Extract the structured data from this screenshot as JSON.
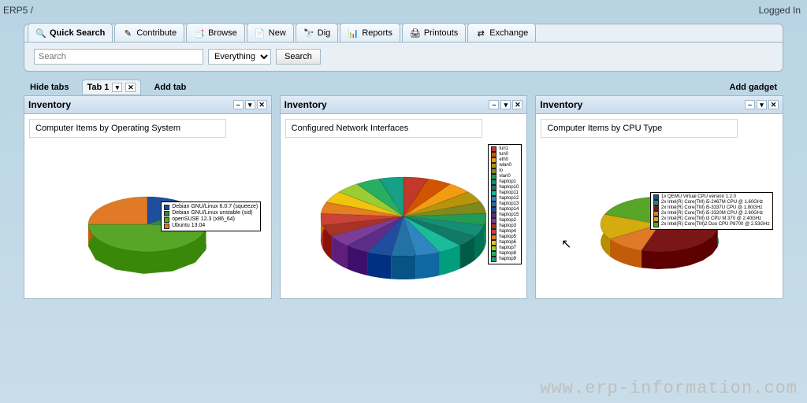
{
  "breadcrumb": "ERP5 /",
  "login_status": "Logged In",
  "nav": {
    "quick_search": "Quick Search",
    "contribute": "Contribute",
    "browse": "Browse",
    "new": "New",
    "dig": "Dig",
    "reports": "Reports",
    "printouts": "Printouts",
    "exchange": "Exchange"
  },
  "search": {
    "placeholder": "Search",
    "select": "Everything",
    "button": "Search"
  },
  "tabbar": {
    "hide": "Hide tabs",
    "tab1": "Tab 1",
    "add_tab": "Add tab",
    "add_gadget": "Add gadget"
  },
  "gadgets": [
    {
      "title": "Inventory",
      "subtitle": "Computer Items by Operating System"
    },
    {
      "title": "Inventory",
      "subtitle": "Configured Network Interfaces"
    },
    {
      "title": "Inventory",
      "subtitle": "Computer Items by CPU Type"
    }
  ],
  "chart_data": [
    {
      "type": "pie",
      "title": "Computer Items by Operating System",
      "series": [
        {
          "name": "Debian GNU/Linux 6.0.7 (squeeze)",
          "value": 15,
          "color": "#1f4e9e"
        },
        {
          "name": "Debian GNU/Linux unstable (sid)",
          "value": 12,
          "color": "#2e8b3d"
        },
        {
          "name": "openSUSE 12.3 (x86_64)",
          "value": 48,
          "color": "#58a628"
        },
        {
          "name": "Ubuntu 13.04",
          "value": 25,
          "color": "#e07a26"
        }
      ]
    },
    {
      "type": "pie",
      "title": "Configured Network Interfaces",
      "series": [
        {
          "name": "tun1",
          "value": 1,
          "color": "#c0392b"
        },
        {
          "name": "tun0",
          "value": 1,
          "color": "#d35400"
        },
        {
          "name": "eth0",
          "value": 1,
          "color": "#f39c12"
        },
        {
          "name": "wlan0",
          "value": 1,
          "color": "#b7950b"
        },
        {
          "name": "lo",
          "value": 1,
          "color": "#7d8a1c"
        },
        {
          "name": "vlan0",
          "value": 1,
          "color": "#239b56"
        },
        {
          "name": "haptop1",
          "value": 1,
          "color": "#148f77"
        },
        {
          "name": "haptop10",
          "value": 1,
          "color": "#117a65"
        },
        {
          "name": "haptop11",
          "value": 1,
          "color": "#1abc9c"
        },
        {
          "name": "haptop12",
          "value": 1,
          "color": "#2e86c1"
        },
        {
          "name": "haptop13",
          "value": 1,
          "color": "#2471a3"
        },
        {
          "name": "haptop14",
          "value": 1,
          "color": "#1f4e9e"
        },
        {
          "name": "haptop15",
          "value": 1,
          "color": "#5b2c8a"
        },
        {
          "name": "haptop2",
          "value": 1,
          "color": "#7d3c98"
        },
        {
          "name": "haptop3",
          "value": 1,
          "color": "#a93226"
        },
        {
          "name": "haptop4",
          "value": 1,
          "color": "#cb4335"
        },
        {
          "name": "haptop5",
          "value": 1,
          "color": "#e67e22"
        },
        {
          "name": "haptop6",
          "value": 1,
          "color": "#f1c40f"
        },
        {
          "name": "haptop7",
          "value": 1,
          "color": "#9acd32"
        },
        {
          "name": "haptop8",
          "value": 1,
          "color": "#27ae60"
        },
        {
          "name": "haptop9",
          "value": 1,
          "color": "#16a085"
        }
      ]
    },
    {
      "type": "pie",
      "title": "Computer Items by CPU Type",
      "series": [
        {
          "name": "1x QEMU Virtual CPU version 1.2.0",
          "value": 14,
          "color": "#1f4e9e"
        },
        {
          "name": "2x Intel(R) Core(TM) i5-2467M CPU @ 1.60GHz",
          "value": 14,
          "color": "#148f77"
        },
        {
          "name": "2x Intel(R) Core(TM) i5-3337U CPU @ 1.80GHz",
          "value": 27,
          "color": "#7a1616"
        },
        {
          "name": "2x Intel(R) Core(TM) i5-3320M CPU @ 2.60GHz",
          "value": 11,
          "color": "#e07a26"
        },
        {
          "name": "2x Intel(R) Core(TM) i3 CPU M 370 @ 2.40GHz",
          "value": 15,
          "color": "#d4ac0d"
        },
        {
          "name": "2x Intel(R) Core(TM)2 Duo CPU P8700 @ 2.53GHz",
          "value": 19,
          "color": "#58a628"
        }
      ]
    }
  ],
  "watermark": "www.erp-information.com"
}
